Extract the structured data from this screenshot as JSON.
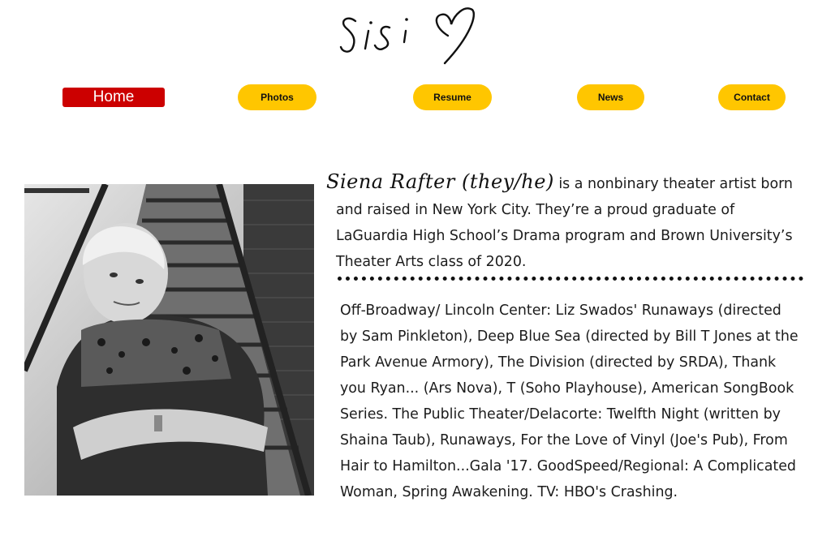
{
  "logo": {
    "text": "Sisi",
    "icon": "heart-icon"
  },
  "nav": {
    "home": "Home",
    "photos": "Photos",
    "resume": "Resume",
    "news": "News",
    "contact": "Contact"
  },
  "colors": {
    "home_bg": "#cc0000",
    "nav_bg": "#ffc600"
  },
  "bio": {
    "name": "Siena Rafter (they/he)",
    "text": " is a nonbinary theater artist born and raised in New York City. They’re a proud graduate of LaGuardia High School’s Drama program and Brown University’s Theater Arts class of 2020."
  },
  "credits": "Off-Broadway/ Lincoln Center: Liz Swados' Runaways (directed by Sam Pinkleton), Deep Blue Sea (directed by Bill T Jones at the Park Avenue Armory), The Division (directed by SRDA), Thank you Ryan... (Ars Nova), T (Soho Playhouse), American SongBook Series. The Public Theater/Delacorte: Twelfth Night (written by Shaina Taub), Runaways, For the Love of Vinyl (Joe's Pub), From Hair to Hamilton...Gala '17. GoodSpeed/Regional: A Complicated Woman, Spring Awakening. TV: HBO's Crashing."
}
